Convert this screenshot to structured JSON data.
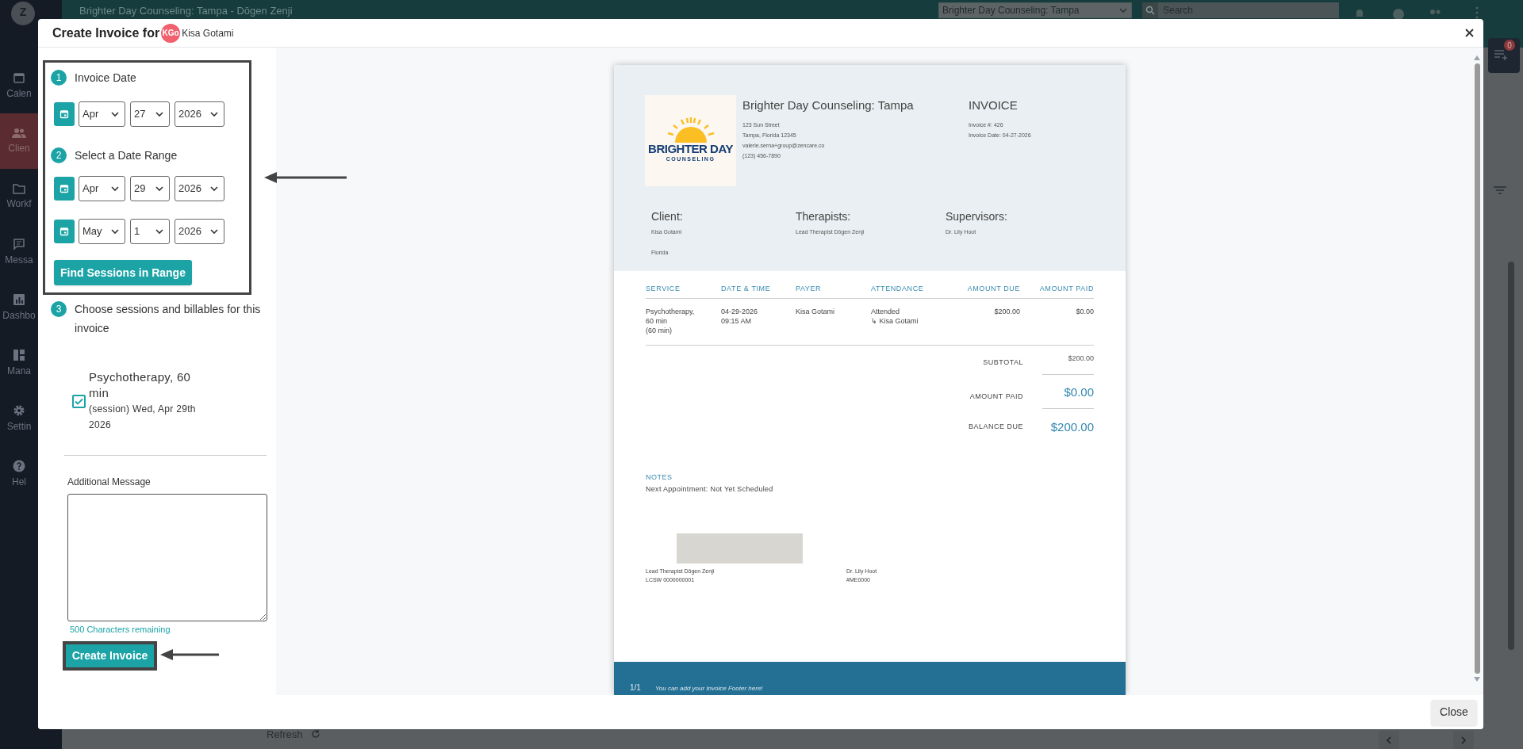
{
  "app": {
    "avatar": "Z",
    "title": "Brighter Day Counseling: Tampa - Dōgen Zenji",
    "location_select": "Brighter Day Counseling: Tampa",
    "search": {
      "placeholder": "Search"
    },
    "sidebar": {
      "items": [
        {
          "label": "Calen",
          "selected": false
        },
        {
          "label": "Clien",
          "selected": true
        },
        {
          "label": "Workf",
          "selected": false
        },
        {
          "label": "Messa",
          "selected": false
        },
        {
          "label": "Dashbo",
          "selected": false
        },
        {
          "label": "Mana",
          "selected": false
        },
        {
          "label": "Settin",
          "selected": false
        },
        {
          "label": "Hel",
          "selected": false
        }
      ]
    },
    "notification_count": "0",
    "refresh": "Refresh"
  },
  "modal": {
    "title": "Create Invoice for",
    "client_initials": "KGo",
    "client_name": "Kisa Gotami",
    "invoice_date": {
      "step": "1",
      "label": "Invoice Date",
      "month": "Apr",
      "day": "27",
      "year": "2026"
    },
    "date_range": {
      "step": "2",
      "label": "Select a Date Range",
      "rows": [
        {
          "month": "Apr",
          "day": "29",
          "year": "2026"
        },
        {
          "month": "May",
          "day": "1",
          "year": "2026"
        }
      ],
      "button": "Find Sessions in Range"
    },
    "sessions": {
      "step": "3",
      "label": "Choose sessions and billables for this invoice",
      "items": [
        {
          "title": "Psychotherapy, 60 min",
          "detail": "(session) Wed, Apr 29th 2026",
          "checked": true
        }
      ]
    },
    "message": {
      "label": "Additional Message",
      "remaining": "500 Characters remaining"
    },
    "create_button": "Create Invoice",
    "close_button": "Close"
  },
  "invoice": {
    "logo": {
      "line1": "BRIGHTER DAY",
      "line2": "COUNSELING"
    },
    "practice_name": "Brighter Day Counseling: Tampa",
    "address_lines": [
      "123 Sun Street",
      "Tampa, Florida 12345",
      "valerie.serna+group@zencare.co",
      "(123) 456-7890"
    ],
    "title": "INVOICE",
    "meta": [
      "Invoice #: 426",
      "Invoice Date: 04-27-2026"
    ],
    "parties": [
      {
        "heading": "Client:",
        "lines": [
          "Kisa Gotami",
          "Florida"
        ]
      },
      {
        "heading": "Therapists:",
        "lines": [
          "Lead Therapist Dōgen Zenji"
        ]
      },
      {
        "heading": "Supervisors:",
        "lines": [
          "Dr. Lily Hoot"
        ]
      }
    ],
    "table": {
      "columns": [
        "SERVICE",
        "DATE & TIME",
        "PAYER",
        "ATTENDANCE",
        "AMOUNT DUE",
        "AMOUNT PAID"
      ],
      "rows": [
        {
          "cells": [
            [
              "Psychotherapy,",
              "60 min",
              "(60 min)"
            ],
            [
              "04-29-2026",
              "09:15 AM"
            ],
            [
              "Kisa Gotami"
            ],
            [
              "Attended",
              "↳ Kisa Gotami"
            ],
            [
              "$200.00"
            ],
            [
              "$0.00"
            ]
          ]
        }
      ]
    },
    "totals": [
      {
        "label": "SUBTOTAL",
        "value": "$200.00",
        "kind": "plain"
      },
      {
        "label": "AMOUNT PAID",
        "value": "$0.00",
        "kind": "large"
      },
      {
        "label": "BALANCE DUE",
        "value": "$200.00",
        "kind": "large"
      }
    ],
    "notes": {
      "heading": "NOTES",
      "text": "Next Appointment: Not Yet Scheduled"
    },
    "signatures": [
      {
        "name": "Lead Therapist Dōgen Zenji",
        "credential": "LCSW 0000000001",
        "signature": true
      },
      {
        "name": "Dr. Lily Hoot",
        "credential": "#ME0000",
        "signature": false
      }
    ],
    "footer": {
      "page": "1/1",
      "text": "You can add your Invoice Footer here!"
    }
  }
}
